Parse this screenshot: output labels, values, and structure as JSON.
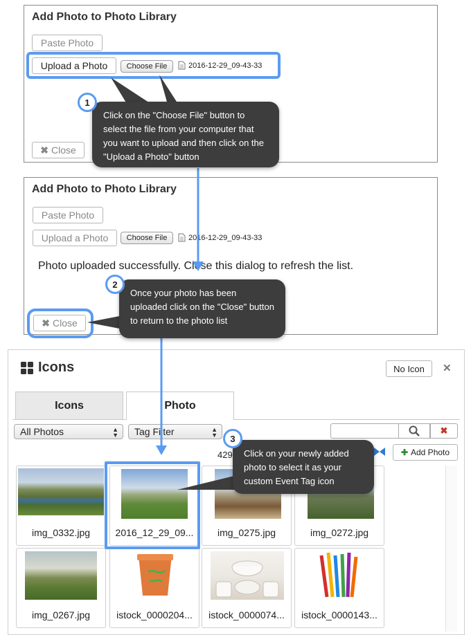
{
  "dialog1": {
    "title": "Add Photo to Photo Library",
    "paste_label": "Paste Photo",
    "upload_label": "Upload a Photo",
    "choose_label": "Choose File",
    "file_name": "2016-12-29_09-43-33",
    "close_label": "Close"
  },
  "dialog2": {
    "title": "Add Photo to Photo Library",
    "paste_label": "Paste Photo",
    "upload_label": "Upload a Photo",
    "choose_label": "Choose File",
    "file_name": "2016-12-29_09-43-33",
    "message": "Photo uploaded successfully. Close this dialog to refresh the list.",
    "close_label": "Close"
  },
  "callouts": [
    {
      "number": "1",
      "text": "Click on the \"Choose File\" button to select the file from your computer that you want to upload and then click on the \"Upload a Photo\" button"
    },
    {
      "number": "2",
      "text": "Once your photo has been uploaded click on the \"Close\" button to return to the photo list"
    },
    {
      "number": "3",
      "text": "Click on your newly added photo to select it as your custom Event Tag icon"
    }
  ],
  "icons_panel": {
    "title": "Icons",
    "no_icon_label": "No Icon",
    "tabs": [
      {
        "label": "Icons"
      },
      {
        "label": "Photo"
      }
    ],
    "filter_selected": "All Photos",
    "tag_filter": "Tag Filter",
    "count_text": "429",
    "add_photo_label": "Add Photo",
    "photos": [
      {
        "caption": "img_0332.jpg"
      },
      {
        "caption": "2016_12_29_09..."
      },
      {
        "caption": "img_0275.jpg"
      },
      {
        "caption": "img_0272.jpg"
      },
      {
        "caption": "img_0267.jpg"
      },
      {
        "caption": "istock_0000204..."
      },
      {
        "caption": "istock_0000074..."
      },
      {
        "caption": "istock_0000143..."
      }
    ]
  },
  "colors": {
    "accent": "#5b9bf0",
    "callout_bg": "#3d3d3d",
    "delete_red": "#c0392b",
    "add_green": "#2e8b3a"
  }
}
